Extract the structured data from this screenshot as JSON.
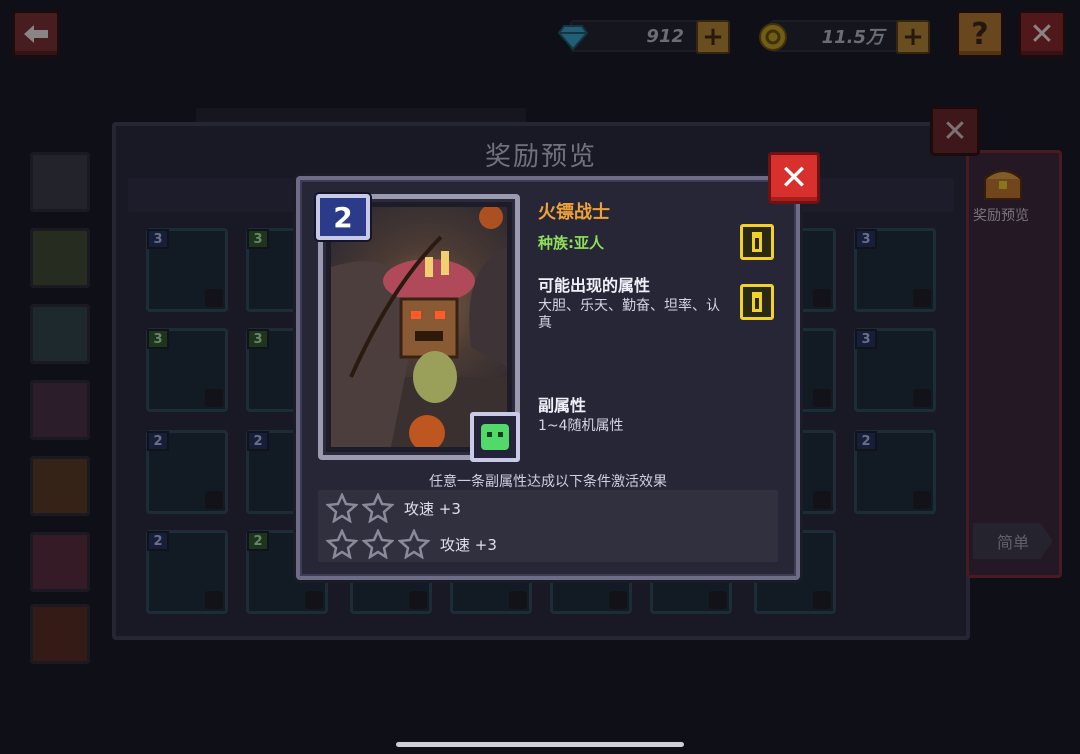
{
  "topbar": {
    "back_icon": "arrow-left-icon",
    "gem_count": "912",
    "gold_count": "11.5万",
    "plus_label": "+",
    "help_label": "?",
    "close_label": "✕"
  },
  "background": {
    "panel_title": "奖励预览",
    "right_panel_label": "奖励预览",
    "difficulty_button": "简单",
    "panel_close_label": "✕",
    "grid_levels": [
      "3",
      "3",
      "3",
      "3",
      "3",
      "3",
      "2",
      "2",
      "2",
      "2",
      "2",
      "2"
    ]
  },
  "popup": {
    "close_label": "✕",
    "card_level": "2",
    "card_name": "火镖战士",
    "race_label": "种族:亚人",
    "possible_attrs_title": "可能出现的属性",
    "possible_attrs_text": "大胆、乐天、勤奋、坦率、认真",
    "sub_attr_title": "副属性",
    "sub_attr_text": "1~4随机属性",
    "condition_text": "任意一条副属性达成以下条件激活效果",
    "conditions": [
      {
        "stars": 2,
        "label": "攻速 +3"
      },
      {
        "stars": 3,
        "label": "攻速 +3"
      }
    ]
  },
  "colors": {
    "name": "#f0a23a",
    "race": "#8ee05a",
    "close": "#d8302c",
    "info": "#f2d22a"
  }
}
